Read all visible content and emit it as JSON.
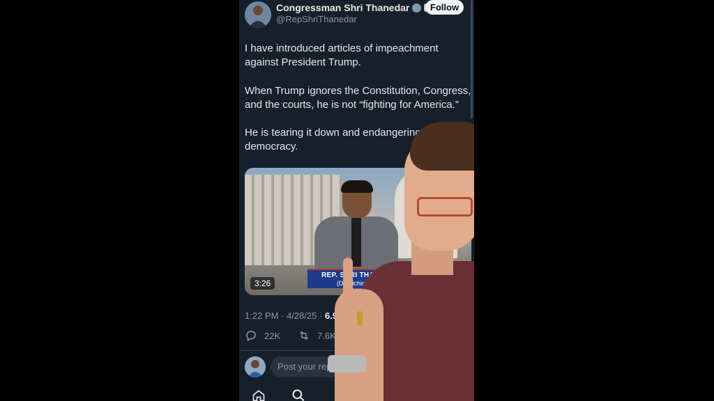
{
  "tweet": {
    "author_name": "Congressman Shri Thanedar",
    "handle": "@RepShriThanedar",
    "follow_label": "Follow",
    "paragraphs": [
      "I have introduced articles of impeachment against President Trump.",
      "When Trump ignores the Constitution, Congress, and the courts, he is not “fighting for America.”",
      "He is tearing it down and endangering our democracy."
    ],
    "video": {
      "duration": "3:26",
      "banner_name": "REP. SHRI THANEDAR",
      "banner_sub": "(D) Michigan"
    },
    "meta_time": "1:22 PM · 4/28/25 · ",
    "meta_views": "6.9M",
    "replies": "22K",
    "retweets": "7.6K",
    "reply_placeholder": "Post your reply"
  },
  "icons": [
    "verified-badge-icon",
    "government-badge-icon",
    "reply-icon",
    "retweet-icon",
    "home-icon",
    "search-icon"
  ],
  "colors": {
    "background": "#15202b",
    "text": "#e7e9ea",
    "muted": "#8b98a5",
    "follow_bg": "#eff3f4"
  }
}
